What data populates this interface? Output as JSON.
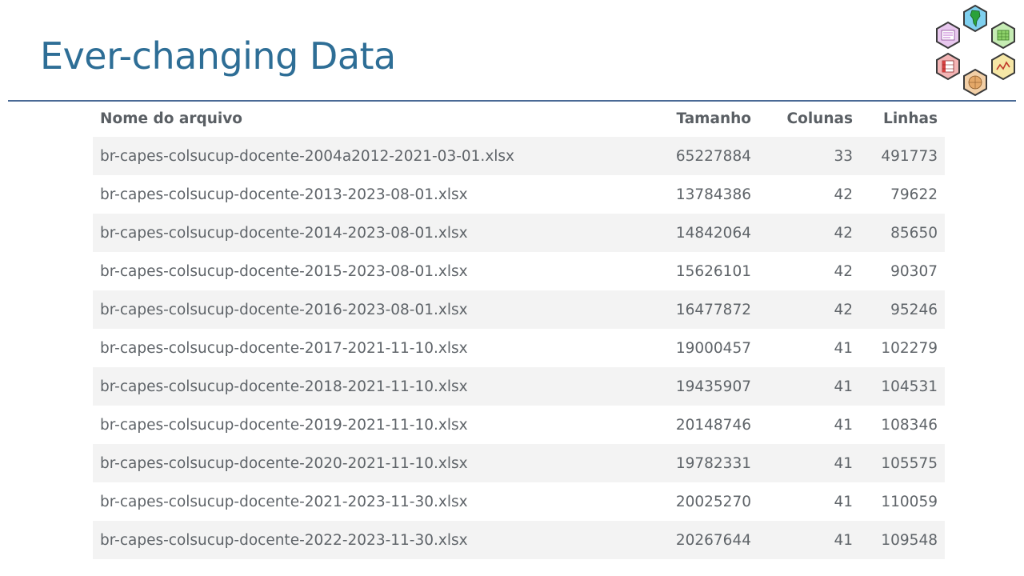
{
  "slide": {
    "title": "Ever-changing Data"
  },
  "logo": {
    "icon": "hex-logo-icon"
  },
  "table": {
    "headers": {
      "name": "Nome do arquivo",
      "size": "Tamanho",
      "columns": "Colunas",
      "rows": "Linhas"
    },
    "rows": [
      {
        "name": "br-capes-colsucup-docente-2004a2012-2021-03-01.xlsx",
        "size": "65227884",
        "columns": "33",
        "rows": "491773"
      },
      {
        "name": "br-capes-colsucup-docente-2013-2023-08-01.xlsx",
        "size": "13784386",
        "columns": "42",
        "rows": "79622"
      },
      {
        "name": "br-capes-colsucup-docente-2014-2023-08-01.xlsx",
        "size": "14842064",
        "columns": "42",
        "rows": "85650"
      },
      {
        "name": "br-capes-colsucup-docente-2015-2023-08-01.xlsx",
        "size": "15626101",
        "columns": "42",
        "rows": "90307"
      },
      {
        "name": "br-capes-colsucup-docente-2016-2023-08-01.xlsx",
        "size": "16477872",
        "columns": "42",
        "rows": "95246"
      },
      {
        "name": "br-capes-colsucup-docente-2017-2021-11-10.xlsx",
        "size": "19000457",
        "columns": "41",
        "rows": "102279"
      },
      {
        "name": "br-capes-colsucup-docente-2018-2021-11-10.xlsx",
        "size": "19435907",
        "columns": "41",
        "rows": "104531"
      },
      {
        "name": "br-capes-colsucup-docente-2019-2021-11-10.xlsx",
        "size": "20148746",
        "columns": "41",
        "rows": "108346"
      },
      {
        "name": "br-capes-colsucup-docente-2020-2021-11-10.xlsx",
        "size": "19782331",
        "columns": "41",
        "rows": "105575"
      },
      {
        "name": "br-capes-colsucup-docente-2021-2023-11-30.xlsx",
        "size": "20025270",
        "columns": "41",
        "rows": "110059"
      },
      {
        "name": "br-capes-colsucup-docente-2022-2023-11-30.xlsx",
        "size": "20267644",
        "columns": "41",
        "rows": "109548"
      }
    ]
  }
}
